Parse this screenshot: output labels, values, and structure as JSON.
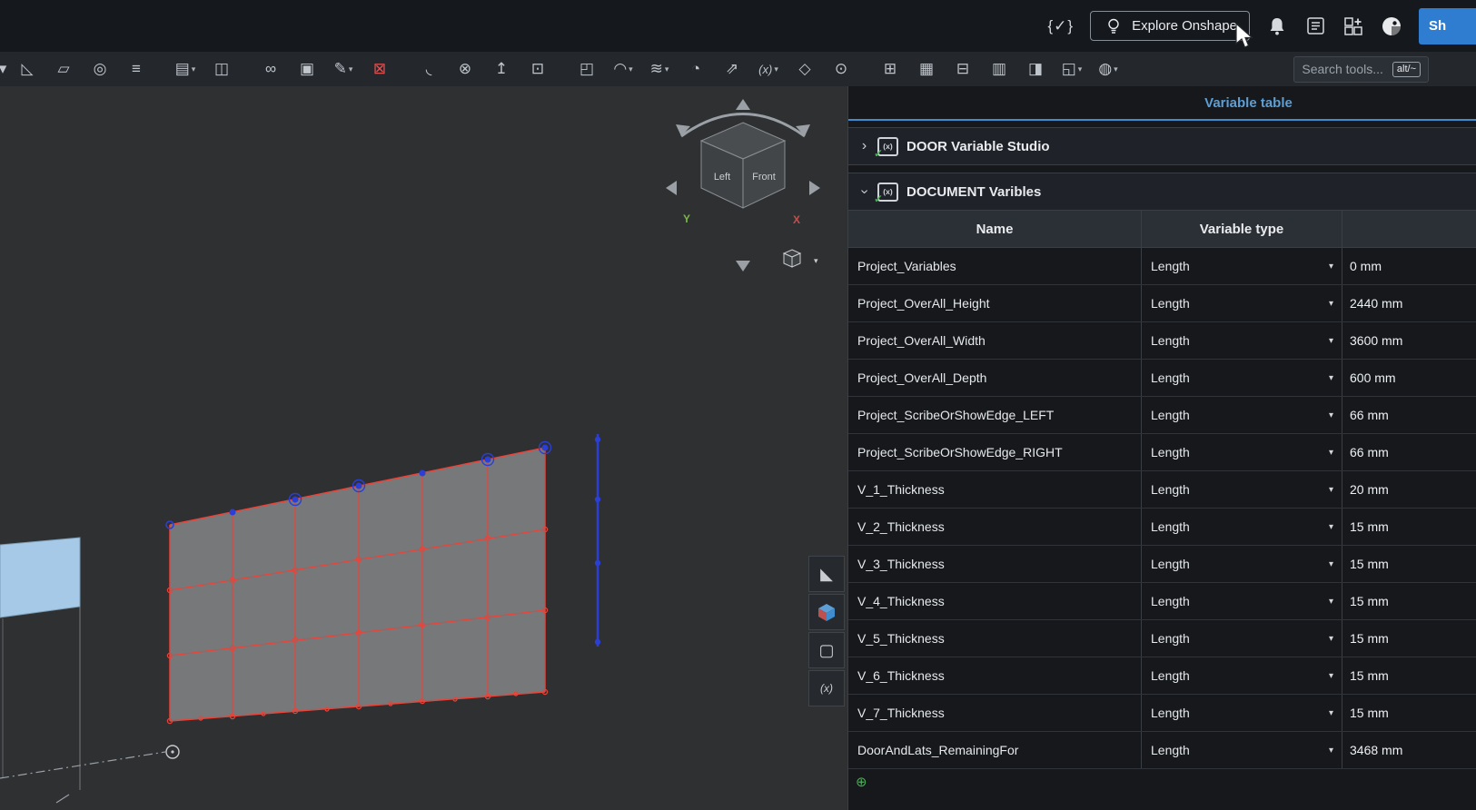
{
  "colors": {
    "accent_blue": "#3f8cce",
    "panel_title_blue": "#5d9fd4",
    "share_button_blue": "#2e7dd1",
    "sketch_red": "#e8443a",
    "sketch_blue": "#2b3fd7",
    "selected_face_blue": "#a5c9e6",
    "axis_y_green": "#7ab648",
    "axis_x_red": "#c0504d",
    "studio_check_green": "#45b054"
  },
  "topbar": {
    "featurescript_label": "{✓}",
    "explore_button_label": "Explore Onshape",
    "share_button_label": "Sh",
    "icons": [
      "lightbulb-icon",
      "bell-icon",
      "tasks-icon",
      "apps-icon",
      "help-icon"
    ]
  },
  "toolbar": {
    "search_placeholder": "Search tools...",
    "search_shortcut": "alt/~",
    "tools": [
      {
        "name": "chevron-cut-icon",
        "glyph": "▾",
        "cut": true
      },
      {
        "name": "sketch-icon",
        "glyph": "◺"
      },
      {
        "name": "extrude-icon",
        "glyph": "▱"
      },
      {
        "name": "revolve-icon",
        "glyph": "◎"
      },
      {
        "name": "sweep-icon",
        "glyph": "≡",
        "group_end": true
      },
      {
        "name": "linear-pattern-icon",
        "glyph": "▤",
        "chevron": true
      },
      {
        "name": "curve-pattern-icon",
        "glyph": "◫",
        "group_end": true
      },
      {
        "name": "boolean-icon",
        "glyph": "∞"
      },
      {
        "name": "split-icon",
        "glyph": "▣"
      },
      {
        "name": "modify-icon",
        "glyph": "✎",
        "chevron": true
      },
      {
        "name": "delete-part-icon",
        "glyph": "⊠",
        "accent": "red",
        "group_end": true
      },
      {
        "name": "fillet-icon",
        "glyph": "◟"
      },
      {
        "name": "delete-face-icon",
        "glyph": "⊗"
      },
      {
        "name": "move-face-icon",
        "glyph": "↥"
      },
      {
        "name": "replace-face-icon",
        "glyph": "⊡",
        "group_end": true
      },
      {
        "name": "plane-icon",
        "glyph": "◰"
      },
      {
        "name": "curve-icon",
        "glyph": "◠",
        "chevron": true
      },
      {
        "name": "surface-pattern-icon",
        "glyph": "≋",
        "chevron": true
      },
      {
        "name": "section-view-icon",
        "glyph": "◔"
      },
      {
        "name": "transform-icon",
        "glyph": "⇗"
      },
      {
        "name": "variable-icon",
        "glyph": "(x)",
        "vx": true,
        "chevron": true
      },
      {
        "name": "mate-connector-icon",
        "glyph": "◇"
      },
      {
        "name": "tag-icon",
        "glyph": "⊙",
        "group_end": true
      },
      {
        "name": "measure-icon",
        "glyph": "⊞"
      },
      {
        "name": "analysis-icon",
        "glyph": "▦"
      },
      {
        "name": "sheet-metal-icon",
        "glyph": "⊟"
      },
      {
        "name": "frame-icon",
        "glyph": "▥"
      },
      {
        "name": "export-icon",
        "glyph": "◨"
      },
      {
        "name": "derived-icon",
        "glyph": "◱",
        "chevron": true
      },
      {
        "name": "appearance-icon",
        "glyph": "◍",
        "chevron": true
      }
    ]
  },
  "viewcube": {
    "face_left": "Left",
    "face_front": "Front",
    "axis_y": "Y",
    "axis_x": "X"
  },
  "panel": {
    "title": "Variable table",
    "sections": [
      {
        "label": "DOOR Variable Studio",
        "state": "collapsed"
      },
      {
        "label": "DOCUMENT Varibles",
        "state": "expanded"
      }
    ],
    "table": {
      "col_name": "Name",
      "col_type": "Variable type",
      "rows": [
        {
          "name": "Project_Variables",
          "type": "Length",
          "value": "0 mm"
        },
        {
          "name": "Project_OverAll_Height",
          "type": "Length",
          "value": "2440 mm"
        },
        {
          "name": "Project_OverAll_Width",
          "type": "Length",
          "value": "3600 mm"
        },
        {
          "name": "Project_OverAll_Depth",
          "type": "Length",
          "value": "600 mm"
        },
        {
          "name": "Project_ScribeOrShowEdge_LEFT",
          "type": "Length",
          "value": "66 mm"
        },
        {
          "name": "Project_ScribeOrShowEdge_RIGHT",
          "type": "Length",
          "value": "66 mm"
        },
        {
          "name": "V_1_Thickness",
          "type": "Length",
          "value": "20 mm"
        },
        {
          "name": "V_2_Thickness",
          "type": "Length",
          "value": "15 mm"
        },
        {
          "name": "V_3_Thickness",
          "type": "Length",
          "value": "15 mm"
        },
        {
          "name": "V_4_Thickness",
          "type": "Length",
          "value": "15 mm"
        },
        {
          "name": "V_5_Thickness",
          "type": "Length",
          "value": "15 mm"
        },
        {
          "name": "V_6_Thickness",
          "type": "Length",
          "value": "15 mm"
        },
        {
          "name": "V_7_Thickness",
          "type": "Length",
          "value": "15 mm"
        },
        {
          "name": "DoorAndLats_RemainingFor",
          "type": "Length",
          "value": "3468 mm"
        }
      ]
    }
  }
}
